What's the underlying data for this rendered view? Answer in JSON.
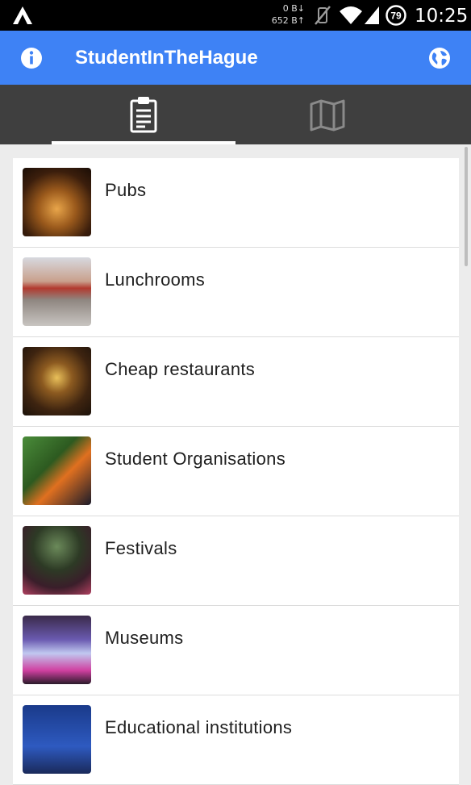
{
  "status_bar": {
    "net_down": "0 B↓",
    "net_up": "652 B↑",
    "battery": "79",
    "time": "10:25"
  },
  "app_bar": {
    "title": "StudentInTheHague",
    "color": "#3e82f5"
  },
  "tabs": [
    {
      "name": "list",
      "icon": "clipboard-icon",
      "selected": true
    },
    {
      "name": "map",
      "icon": "map-icon",
      "selected": false
    }
  ],
  "categories": [
    {
      "label": "Pubs"
    },
    {
      "label": "Lunchrooms"
    },
    {
      "label": "Cheap restaurants"
    },
    {
      "label": "Student Organisations"
    },
    {
      "label": "Festivals"
    },
    {
      "label": "Museums"
    },
    {
      "label": "Educational institutions"
    }
  ]
}
